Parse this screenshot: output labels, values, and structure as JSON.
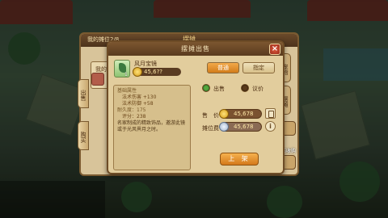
{
  "background_panel": {
    "title": "我的摊位2/8",
    "heading": "摆摊",
    "card_label": "我的",
    "left_tabs": [
      "出售",
      "购买",
      "收购"
    ],
    "right_tabs": [
      "宠物",
      "摆摊"
    ],
    "side_label": "发布收购"
  },
  "dialog": {
    "title": "摆摊出售",
    "close_label": "×",
    "item": {
      "name": "风月宝镜",
      "quantity": "1",
      "reference_price": "45,6??"
    },
    "stats": {
      "section_basic": "基础属性",
      "attr_1": "法术伤害 +130",
      "attr_2": "法术防御 +58",
      "durability": "耐久度：175",
      "rating": "评分：238",
      "description": "名家制成的精致饰品，邀游此镜或于光风霁月之时。"
    },
    "mode_tabs": {
      "normal": "普通",
      "specified": "指定"
    },
    "options": {
      "sell": "出售",
      "negotiate": "议价"
    },
    "price_label": "售　价",
    "price_value": "45,678",
    "fee_label": "摊位费",
    "fee_value": "45,678",
    "info_label": "i",
    "list_button": "上 架"
  },
  "colors": {
    "accent_orange": "#d27c1a",
    "frame_brown": "#6e4c26",
    "panel_tan": "#e2cd9d"
  }
}
